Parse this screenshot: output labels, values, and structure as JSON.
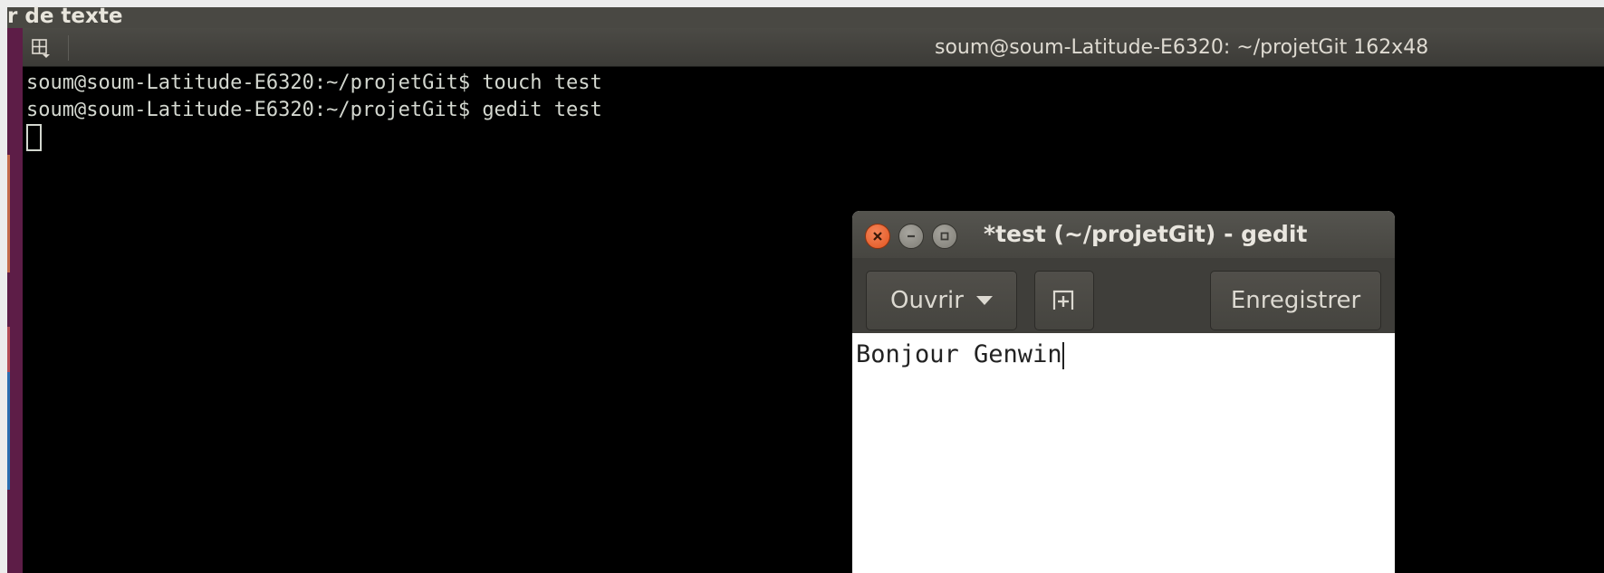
{
  "background_window": {
    "title_fragment": "r de texte"
  },
  "terminal": {
    "title": "soum@soum-Latitude-E6320: ~/projetGit 162x48",
    "lines": [
      "soum@soum-Latitude-E6320:~/projetGit$ touch test",
      "soum@soum-Latitude-E6320:~/projetGit$ gedit test"
    ],
    "tab_icon": "terminal-tabs-icon"
  },
  "gedit": {
    "title": "*test (~/projetGit) - gedit",
    "toolbar": {
      "open_label": "Ouvrir",
      "new_tab_icon": "new-document-icon",
      "save_label": "Enregistrer"
    },
    "editor_text": "Bonjour Genwin"
  },
  "colors": {
    "terminal_bg": "#000000",
    "terminal_fg": "#d3d7cf",
    "titlebar": "#494843",
    "close_button": "#e2541f",
    "launcher": "#5d1d47"
  }
}
